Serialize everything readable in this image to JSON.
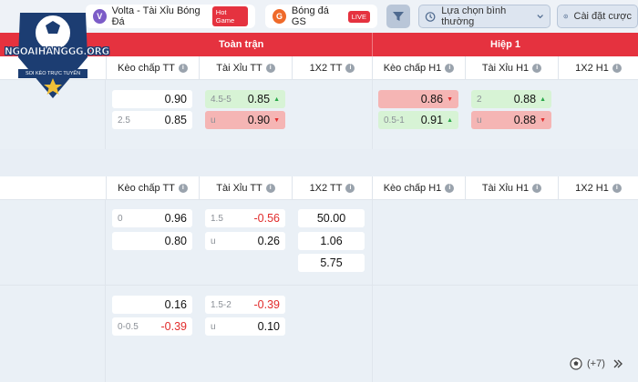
{
  "topbar": {
    "tab1": {
      "label": "Volta - Tài Xỉu Bóng Đá",
      "badge": "Hot Game",
      "icon": "volta-icon"
    },
    "tab2": {
      "label": "Bóng đá GS",
      "badge": "LIVE",
      "icon": "ball-icon"
    },
    "select_label": "Lựa chọn bình thường",
    "settings_label": "Cài đặt cược"
  },
  "logo": {
    "text": "NGOAIHANGGG.ORG",
    "sub": "SOI KÈO TRỰC TUYẾN"
  },
  "header": {
    "full_time": "Toàn trận",
    "half": "Hiệp 1"
  },
  "columns": [
    "Kèo chấp TT",
    "Tài Xỉu TT",
    "1X2 TT",
    "Kèo chấp H1",
    "Tài Xỉu H1",
    "1X2 H1"
  ],
  "match1": {
    "hdp_ft": [
      {
        "line": "",
        "value": "0.90"
      },
      {
        "line": "2.5",
        "value": "0.85"
      }
    ],
    "ou_ft": [
      {
        "line": "4.5-5",
        "value": "0.85"
      },
      {
        "line": "u",
        "value": "0.90"
      }
    ],
    "hdp_h1": [
      {
        "line": "",
        "value": "0.86"
      },
      {
        "line": "0.5-1",
        "value": "0.91"
      }
    ],
    "ou_h1": [
      {
        "line": "2",
        "value": "0.88"
      },
      {
        "line": "u",
        "value": "0.88"
      }
    ]
  },
  "match2": {
    "hdp_ft": [
      {
        "line": "0",
        "value": "0.96"
      },
      {
        "line": "",
        "value": "0.80"
      }
    ],
    "ou_ft": [
      {
        "line": "1.5",
        "value": "-0.56"
      },
      {
        "line": "u",
        "value": "0.26"
      }
    ],
    "x12_ft": [
      "50.00",
      "1.06",
      "5.75"
    ],
    "hdp_ft_2": [
      {
        "line": "",
        "value": "0.16"
      },
      {
        "line": "0-0.5",
        "value": "-0.39"
      }
    ],
    "ou_ft_2": [
      {
        "line": "1.5-2",
        "value": "-0.39"
      },
      {
        "line": "u",
        "value": "0.10"
      }
    ]
  },
  "more": {
    "label": "(+7)"
  }
}
